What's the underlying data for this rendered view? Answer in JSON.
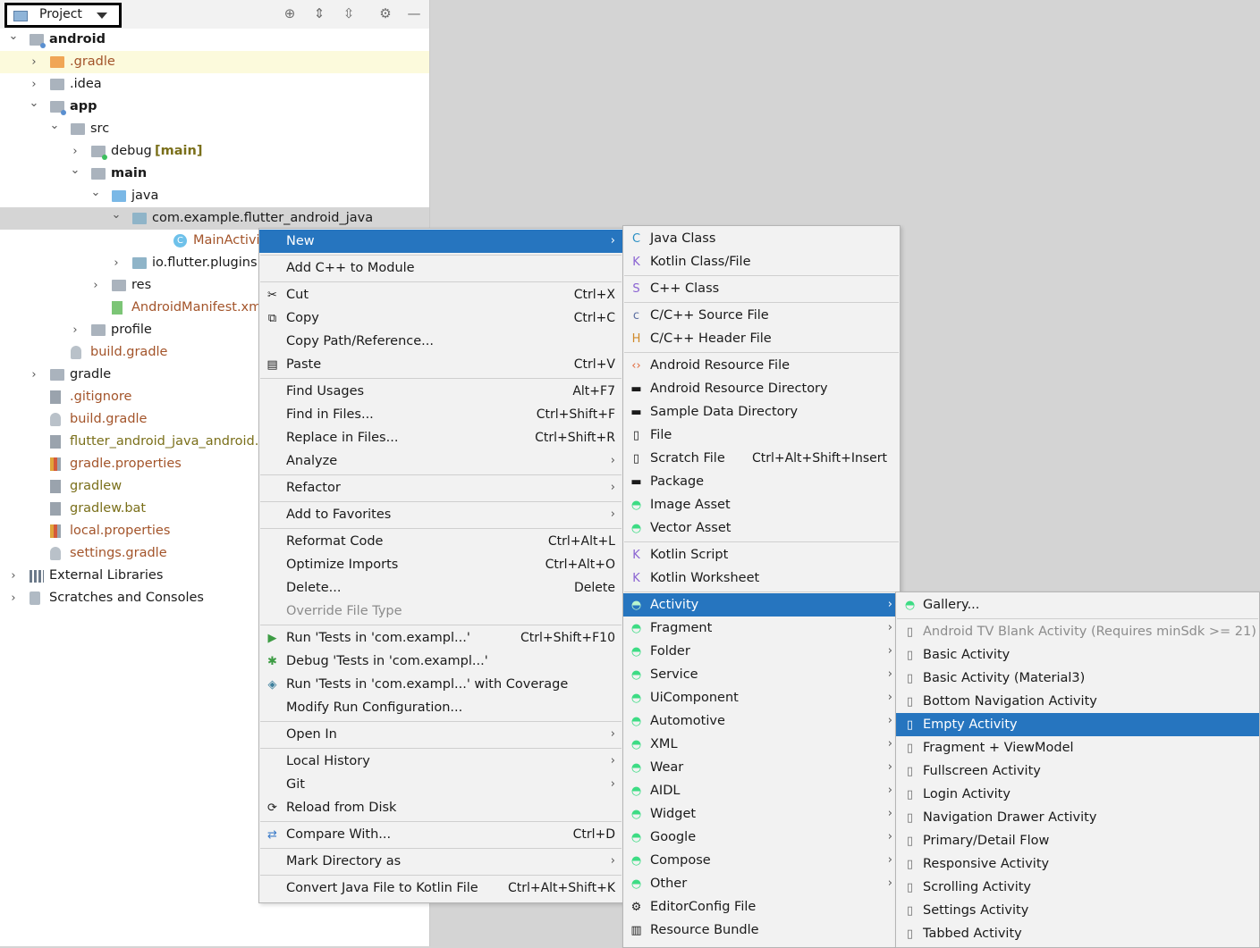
{
  "toolbar": {
    "view_selector": "Project",
    "icons": [
      "locate-icon",
      "expand-all-icon",
      "collapse-all-icon",
      "gear-icon",
      "minimize-icon"
    ]
  },
  "tree": [
    {
      "label": "android",
      "depth": 0,
      "expanded": true,
      "bold": true,
      "icon": "module-folder-icon"
    },
    {
      "label": ".gradle",
      "depth": 1,
      "expanded": false,
      "icon": "folder-orange-icon",
      "style": "orange",
      "highlight": "yellow"
    },
    {
      "label": ".idea",
      "depth": 1,
      "expanded": false,
      "icon": "folder-icon"
    },
    {
      "label": "app",
      "depth": 1,
      "expanded": true,
      "bold": true,
      "icon": "module-folder-icon"
    },
    {
      "label": "src",
      "depth": 2,
      "expanded": true,
      "icon": "folder-icon"
    },
    {
      "label": "debug",
      "suffix": "[main]",
      "depth": 3,
      "expanded": false,
      "icon": "folder-icon"
    },
    {
      "label": "main",
      "depth": 3,
      "expanded": true,
      "bold": true,
      "icon": "folder-icon"
    },
    {
      "label": "java",
      "depth": 4,
      "expanded": true,
      "icon": "folder-blue-icon"
    },
    {
      "label": "com.example.flutter_android_java",
      "depth": 5,
      "expanded": true,
      "icon": "package-icon",
      "highlight": "grey"
    },
    {
      "label": "MainActivity",
      "depth": 7,
      "icon": "class-icon",
      "style": "orange"
    },
    {
      "label": "io.flutter.plugins",
      "depth": 5,
      "expanded": false,
      "icon": "package-icon"
    },
    {
      "label": "res",
      "depth": 4,
      "expanded": false,
      "icon": "res-folder-icon"
    },
    {
      "label": "AndroidManifest.xml",
      "depth": 4,
      "icon": "manifest-icon",
      "style": "orange"
    },
    {
      "label": "profile",
      "depth": 3,
      "expanded": false,
      "icon": "folder-icon"
    },
    {
      "label": "build.gradle",
      "depth": 2,
      "icon": "gradle-icon",
      "style": "orange"
    },
    {
      "label": "gradle",
      "depth": 1,
      "expanded": false,
      "icon": "folder-icon"
    },
    {
      "label": ".gitignore",
      "depth": 1,
      "icon": "gitignore-icon",
      "style": "orange"
    },
    {
      "label": "build.gradle",
      "depth": 1,
      "icon": "gradle-icon",
      "style": "orange"
    },
    {
      "label": "flutter_android_java_android.im",
      "depth": 1,
      "icon": "iml-icon",
      "style": "olive"
    },
    {
      "label": "gradle.properties",
      "depth": 1,
      "icon": "properties-icon",
      "style": "orange"
    },
    {
      "label": "gradlew",
      "depth": 1,
      "icon": "script-icon",
      "style": "olive"
    },
    {
      "label": "gradlew.bat",
      "depth": 1,
      "icon": "bat-icon",
      "style": "olive"
    },
    {
      "label": "local.properties",
      "depth": 1,
      "icon": "properties-icon",
      "style": "orange"
    },
    {
      "label": "settings.gradle",
      "depth": 1,
      "icon": "gradle-icon",
      "style": "orange"
    },
    {
      "label": "External Libraries",
      "depth": 0,
      "expanded": false,
      "icon": "libraries-icon"
    },
    {
      "label": "Scratches and Consoles",
      "depth": 0,
      "expanded": false,
      "icon": "scratches-icon"
    }
  ],
  "context_menu": [
    {
      "label": "New",
      "submenu": true,
      "selected": true
    },
    {
      "sep": true
    },
    {
      "label": "Add C++ to Module"
    },
    {
      "sep": true
    },
    {
      "label": "Cut",
      "shortcut": "Ctrl+X",
      "icon": "scissors-icon"
    },
    {
      "label": "Copy",
      "shortcut": "Ctrl+C",
      "icon": "copy-icon"
    },
    {
      "label": "Copy Path/Reference..."
    },
    {
      "label": "Paste",
      "shortcut": "Ctrl+V",
      "icon": "paste-icon"
    },
    {
      "sep": true
    },
    {
      "label": "Find Usages",
      "shortcut": "Alt+F7"
    },
    {
      "label": "Find in Files...",
      "shortcut": "Ctrl+Shift+F"
    },
    {
      "label": "Replace in Files...",
      "shortcut": "Ctrl+Shift+R"
    },
    {
      "label": "Analyze",
      "submenu": true
    },
    {
      "sep": true
    },
    {
      "label": "Refactor",
      "submenu": true
    },
    {
      "sep": true
    },
    {
      "label": "Add to Favorites",
      "submenu": true
    },
    {
      "sep": true
    },
    {
      "label": "Reformat Code",
      "shortcut": "Ctrl+Alt+L"
    },
    {
      "label": "Optimize Imports",
      "shortcut": "Ctrl+Alt+O"
    },
    {
      "label": "Delete...",
      "shortcut": "Delete"
    },
    {
      "label": "Override File Type",
      "disabled": true
    },
    {
      "sep": true
    },
    {
      "label": "Run 'Tests in 'com.exampl...'",
      "shortcut": "Ctrl+Shift+F10",
      "icon": "run-icon"
    },
    {
      "label": "Debug 'Tests in 'com.exampl...'",
      "icon": "debug-icon"
    },
    {
      "label": "Run 'Tests in 'com.exampl...' with Coverage",
      "icon": "coverage-icon"
    },
    {
      "label": "Modify Run Configuration..."
    },
    {
      "sep": true
    },
    {
      "label": "Open In",
      "submenu": true
    },
    {
      "sep": true
    },
    {
      "label": "Local History",
      "submenu": true
    },
    {
      "label": "Git",
      "submenu": true
    },
    {
      "label": "Reload from Disk",
      "icon": "reload-icon"
    },
    {
      "sep": true
    },
    {
      "label": "Compare With...",
      "shortcut": "Ctrl+D",
      "icon": "compare-icon"
    },
    {
      "sep": true
    },
    {
      "label": "Mark Directory as",
      "submenu": true
    },
    {
      "sep": true
    },
    {
      "label": "Convert Java File to Kotlin File",
      "shortcut": "Ctrl+Alt+Shift+K"
    }
  ],
  "new_menu": [
    {
      "label": "Java Class",
      "icon": "java-class-icon"
    },
    {
      "label": "Kotlin Class/File",
      "icon": "kotlin-file-icon"
    },
    {
      "sep": true
    },
    {
      "label": "C++ Class",
      "icon": "cpp-class-icon"
    },
    {
      "sep": true
    },
    {
      "label": "C/C++ Source File",
      "icon": "cpp-source-icon"
    },
    {
      "label": "C/C++ Header File",
      "icon": "cpp-header-icon"
    },
    {
      "sep": true
    },
    {
      "label": "Android Resource File",
      "icon": "android-resource-file-icon"
    },
    {
      "label": "Android Resource Directory",
      "icon": "folder-icon"
    },
    {
      "label": "Sample Data Directory",
      "icon": "folder-icon"
    },
    {
      "label": "File",
      "icon": "file-icon"
    },
    {
      "label": "Scratch File",
      "shortcut": "Ctrl+Alt+Shift+Insert",
      "icon": "scratch-file-icon"
    },
    {
      "label": "Package",
      "icon": "package-icon"
    },
    {
      "label": "Image Asset",
      "icon": "android-icon"
    },
    {
      "label": "Vector Asset",
      "icon": "android-icon"
    },
    {
      "sep": true
    },
    {
      "label": "Kotlin Script",
      "icon": "kotlin-script-icon"
    },
    {
      "label": "Kotlin Worksheet",
      "icon": "kotlin-worksheet-icon"
    },
    {
      "sep": true
    },
    {
      "label": "Activity",
      "submenu": true,
      "selected": true,
      "icon": "android-icon"
    },
    {
      "label": "Fragment",
      "submenu": true,
      "icon": "android-icon"
    },
    {
      "label": "Folder",
      "submenu": true,
      "icon": "android-icon"
    },
    {
      "label": "Service",
      "submenu": true,
      "icon": "android-icon"
    },
    {
      "label": "UiComponent",
      "submenu": true,
      "icon": "android-icon"
    },
    {
      "label": "Automotive",
      "submenu": true,
      "icon": "android-icon"
    },
    {
      "label": "XML",
      "submenu": true,
      "icon": "android-icon"
    },
    {
      "label": "Wear",
      "submenu": true,
      "icon": "android-icon"
    },
    {
      "label": "AIDL",
      "submenu": true,
      "icon": "android-icon"
    },
    {
      "label": "Widget",
      "submenu": true,
      "icon": "android-icon"
    },
    {
      "label": "Google",
      "submenu": true,
      "icon": "android-icon"
    },
    {
      "label": "Compose",
      "submenu": true,
      "icon": "android-icon"
    },
    {
      "label": "Other",
      "submenu": true,
      "icon": "android-icon"
    },
    {
      "label": "EditorConfig File",
      "icon": "gear-icon"
    },
    {
      "label": "Resource Bundle",
      "icon": "resource-bundle-icon"
    }
  ],
  "activity_menu": [
    {
      "label": "Gallery...",
      "icon": "android-icon"
    },
    {
      "sep": true
    },
    {
      "label": "Android TV Blank Activity (Requires minSdk >= 21)",
      "disabled": true,
      "icon": "phone-icon"
    },
    {
      "label": "Basic Activity",
      "icon": "phone-icon"
    },
    {
      "label": "Basic Activity (Material3)",
      "icon": "phone-icon"
    },
    {
      "label": "Bottom Navigation Activity",
      "icon": "phone-icon"
    },
    {
      "label": "Empty Activity",
      "selected": true,
      "icon": "phone-icon"
    },
    {
      "label": "Fragment + ViewModel",
      "icon": "phone-icon"
    },
    {
      "label": "Fullscreen Activity",
      "icon": "phone-icon"
    },
    {
      "label": "Login Activity",
      "icon": "phone-icon"
    },
    {
      "label": "Navigation Drawer Activity",
      "icon": "phone-icon"
    },
    {
      "label": "Primary/Detail Flow",
      "icon": "phone-icon"
    },
    {
      "label": "Responsive Activity",
      "icon": "phone-icon"
    },
    {
      "label": "Scrolling Activity",
      "icon": "phone-icon"
    },
    {
      "label": "Settings Activity",
      "icon": "phone-icon"
    },
    {
      "label": "Tabbed Activity",
      "icon": "phone-icon"
    }
  ],
  "colors": {
    "selection": "#2675bf",
    "menu_bg": "#f2f2f2",
    "android_green": "#3ddc84",
    "file_orange": "#a3542a"
  }
}
